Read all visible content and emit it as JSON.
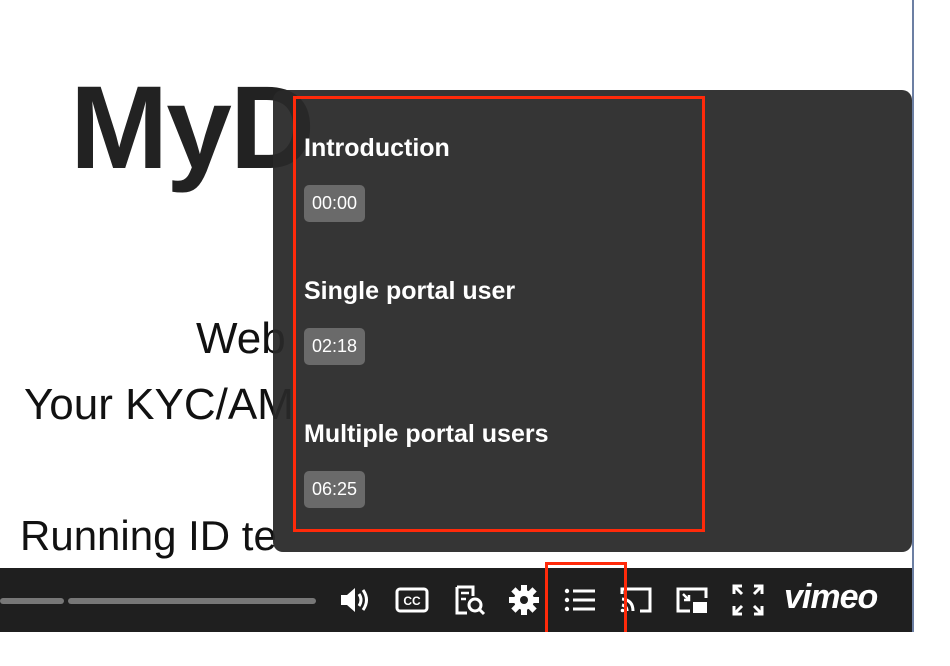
{
  "slide": {
    "logo_text": "MyD",
    "line1": "Web",
    "line2": "Your KYC/AM",
    "line3": "Running ID te"
  },
  "chapters": [
    {
      "title": "Introduction",
      "time": "00:00"
    },
    {
      "title": "Single portal user",
      "time": "02:18"
    },
    {
      "title": "Multiple portal users",
      "time": "06:25"
    }
  ],
  "controls": {
    "cc_label": "CC",
    "brand": "vimeo"
  },
  "colors": {
    "highlight": "#ff2a0a",
    "panel": "#282828",
    "timestamp_bg": "#6a6a6a",
    "logo_green": "#3dae6e",
    "logo_teal": "#2cb8c9"
  }
}
